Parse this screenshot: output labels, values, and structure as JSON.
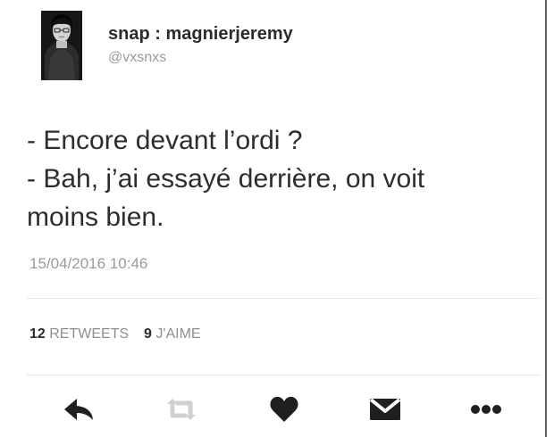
{
  "profile": {
    "display_name": "snap : magnierjeremy",
    "handle": "@vxsnxs"
  },
  "tweet": {
    "lines": [
      "- Encore devant l’ordi ?",
      "- Bah, j’ai essayé derrière, on voit",
      "moins bien."
    ],
    "timestamp": "15/04/2016 10:46"
  },
  "stats": {
    "retweets_count": "12",
    "retweets_label": "RETWEETS",
    "likes_count": "9",
    "likes_label": "J'AIME"
  },
  "actions": [
    {
      "name": "reply-icon"
    },
    {
      "name": "retweet-icon"
    },
    {
      "name": "heart-icon"
    },
    {
      "name": "message-icon"
    },
    {
      "name": "more-icon"
    }
  ],
  "colors": {
    "text": "#2d2d2d",
    "muted": "#9a9a9a",
    "icon": "#1f1f1f",
    "icon_light": "#d0d0d0"
  }
}
